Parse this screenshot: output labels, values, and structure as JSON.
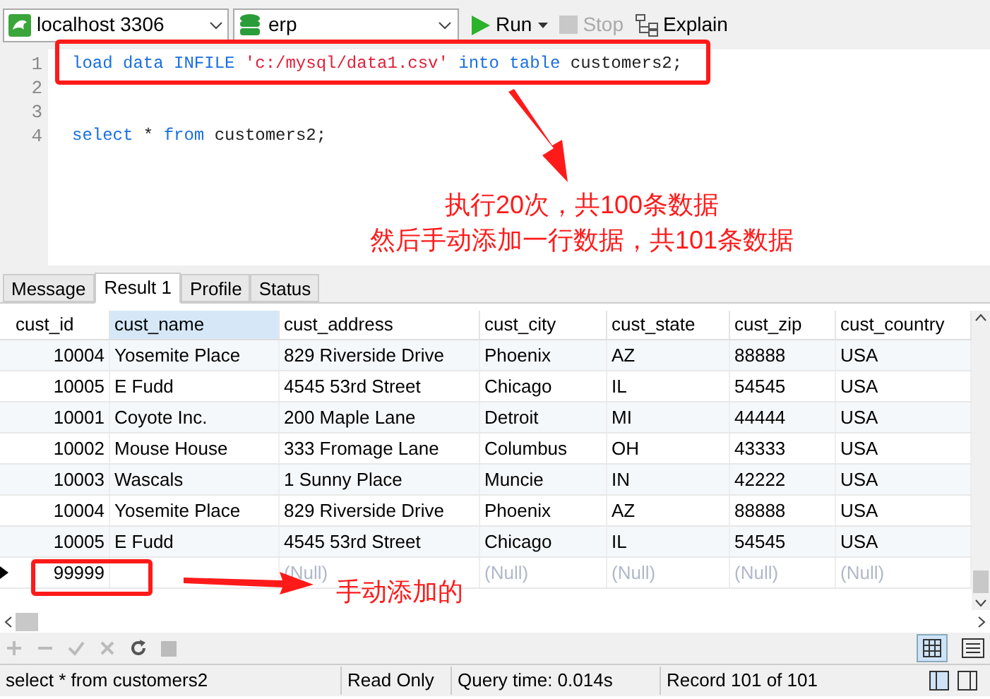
{
  "toolbar": {
    "connection": "localhost 3306",
    "database": "erp",
    "buttons": [
      {
        "kind": "run",
        "label": "Run",
        "disabled": false
      },
      {
        "kind": "stop",
        "label": "Stop",
        "disabled": true
      },
      {
        "kind": "explain",
        "label": "Explain",
        "disabled": false
      }
    ]
  },
  "editor": {
    "lines": [
      {
        "number": "1",
        "tokens": [
          {
            "kind": "kw",
            "text": "load data INFILE "
          },
          {
            "kind": "str",
            "text": "'c:/mysql/data1.csv'"
          },
          {
            "kind": "kw",
            "text": " into table "
          },
          {
            "kind": "id",
            "text": "customers2;"
          }
        ]
      },
      {
        "number": "2"
      },
      {
        "number": "3"
      },
      {
        "number": "4",
        "tokens": [
          {
            "kind": "kw",
            "text": "select"
          },
          {
            "kind": "id",
            "text": " * "
          },
          {
            "kind": "kw",
            "text": "from"
          },
          {
            "kind": "id",
            "text": " customers2;"
          }
        ]
      }
    ]
  },
  "annotations": {
    "top_note": [
      "执行20次，共100条数据",
      "然后手动添加一行数据，共101条数据"
    ],
    "row_note": "手动添加的"
  },
  "tabs": [
    {
      "label": "Message",
      "selected": false
    },
    {
      "label": "Result 1",
      "selected": true
    },
    {
      "label": "Profile",
      "selected": false
    },
    {
      "label": "Status",
      "selected": false
    }
  ],
  "table": {
    "columns": [
      {
        "label": "cust_id",
        "selected": false
      },
      {
        "label": "cust_name",
        "selected": true
      },
      {
        "label": "cust_address",
        "selected": false
      },
      {
        "label": "cust_city",
        "selected": false
      },
      {
        "label": "cust_state",
        "selected": false
      },
      {
        "label": "cust_zip",
        "selected": false
      },
      {
        "label": "cust_country",
        "selected": false
      }
    ],
    "rows": [
      {
        "current": false,
        "cells": [
          "10004",
          "Yosemite Place",
          "829 Riverside Drive",
          "Phoenix",
          "AZ",
          "88888",
          "USA"
        ]
      },
      {
        "current": false,
        "cells": [
          "10005",
          "E Fudd",
          "4545 53rd Street",
          "Chicago",
          "IL",
          "54545",
          "USA"
        ]
      },
      {
        "current": false,
        "cells": [
          "10001",
          "Coyote Inc.",
          "200 Maple Lane",
          "Detroit",
          "MI",
          "44444",
          "USA"
        ]
      },
      {
        "current": false,
        "cells": [
          "10002",
          "Mouse House",
          "333 Fromage Lane",
          "Columbus",
          "OH",
          "43333",
          "USA"
        ]
      },
      {
        "current": false,
        "cells": [
          "10003",
          "Wascals",
          "1 Sunny Place",
          "Muncie",
          "IN",
          "42222",
          "USA"
        ]
      },
      {
        "current": false,
        "cells": [
          "10004",
          "Yosemite Place",
          "829 Riverside Drive",
          "Phoenix",
          "AZ",
          "88888",
          "USA"
        ]
      },
      {
        "current": false,
        "cells": [
          "10005",
          "E Fudd",
          "4545 53rd Street",
          "Chicago",
          "IL",
          "54545",
          "USA"
        ]
      },
      {
        "current": true,
        "cells": [
          "99999",
          null,
          "(Null)",
          "(Null)",
          "(Null)",
          "(Null)",
          "(Null)"
        ]
      }
    ]
  },
  "status_bar": [
    "select * from customers2",
    "Read Only",
    "Query time: 0.014s",
    "Record 101 of 101"
  ]
}
